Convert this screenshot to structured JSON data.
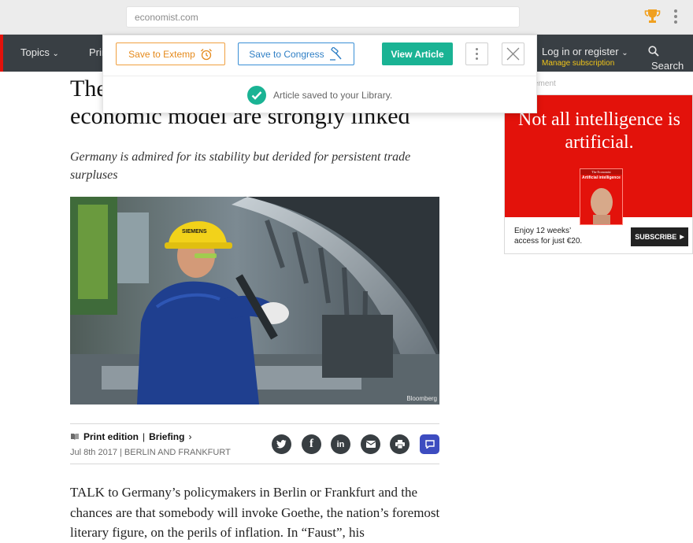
{
  "browser": {
    "url": "economist.com"
  },
  "nav": {
    "topics": "Topics",
    "print": "Print edition",
    "login": "Log in or register",
    "manage": "Manage subscription",
    "search": "Search"
  },
  "popup": {
    "save_extemp": "Save to Extemp",
    "save_congress": "Save to Congress",
    "view_article": "View Article",
    "saved_message": "Article saved to your Library."
  },
  "article": {
    "headline_line1": "The",
    "headline_line2": "economic model are strongly linked",
    "rubric": "Germany is admired for its stability but derided for persistent trade surpluses",
    "image_credit": "Bloomberg",
    "helmet_text": "SIEMENS",
    "section": "Print edition",
    "subsection": "Briefing",
    "date": "Jul 8th 2017",
    "dateline": "BERLIN AND FRANKFURT",
    "body": "TALK to Germany’s policymakers in Berlin or Frankfurt and the chances are that somebody will invoke Goethe, the nation’s foremost literary figure, on the perils of inflation. In “Faust”, his"
  },
  "ad": {
    "label": "ement",
    "headline": "Not all intelligence is artificial.",
    "offer": "Enjoy 12 weeks’ access for just €20.",
    "subscribe": "SUBSCRIBE",
    "cover_title": "Artificial intelligence",
    "cover_brand": "The Economist"
  },
  "colors": {
    "brand_red": "#e3120b",
    "nav_bg": "#393f44",
    "view_green": "#1ab394"
  }
}
